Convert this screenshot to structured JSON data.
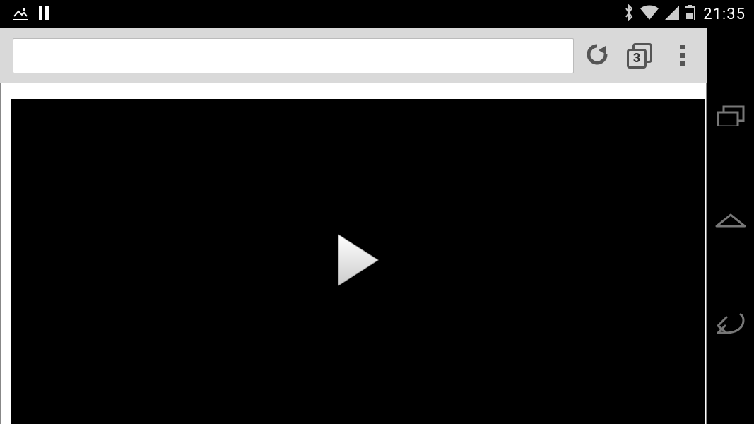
{
  "status_bar": {
    "time": "21:35",
    "icons": {
      "image": "image-icon",
      "pause": "pause-icon",
      "bluetooth": "bluetooth-icon",
      "wifi": "wifi-icon",
      "signal": "signal-icon",
      "battery": "battery-icon"
    }
  },
  "browser": {
    "url_value": "",
    "url_placeholder": "",
    "tab_count": "3",
    "actions": {
      "reload": "reload",
      "tabs": "tabs",
      "menu": "menu"
    }
  },
  "video": {
    "state": "paused",
    "play_label": "Play"
  },
  "nav": {
    "recent": "recent-apps",
    "home": "home",
    "back": "back"
  }
}
